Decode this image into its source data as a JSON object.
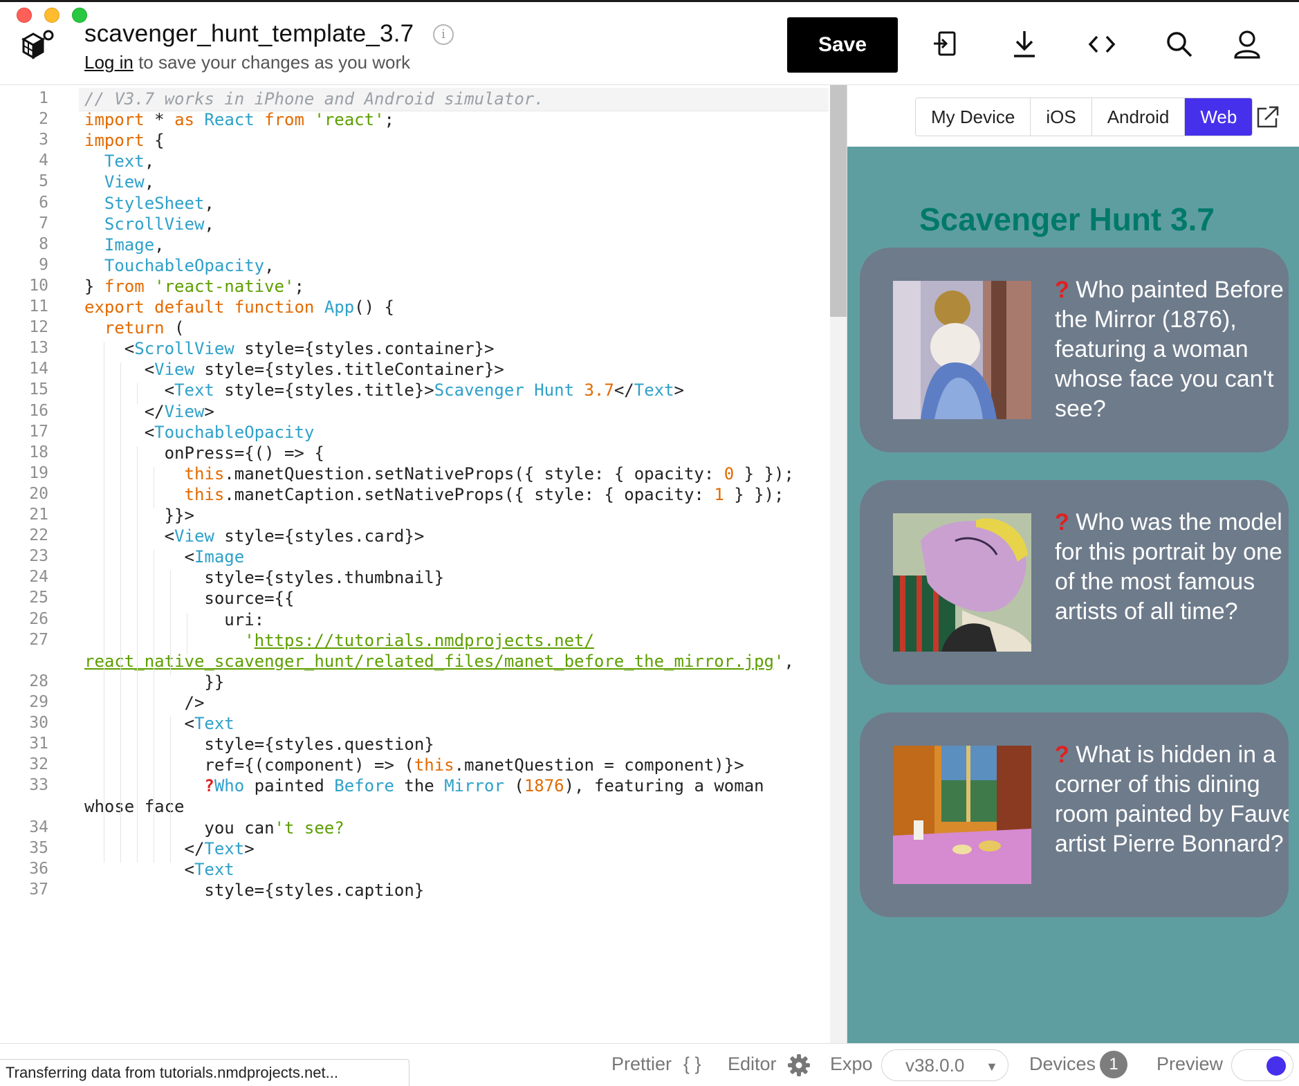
{
  "header": {
    "title": "scavenger_hunt_template_3.7",
    "info_icon": "info-icon",
    "login_link": "Log in",
    "subtitle_rest": " to save your changes as you work",
    "save_label": "Save",
    "icons": [
      "import-project-icon",
      "download-icon",
      "embed-code-icon",
      "search-icon",
      "user-account-icon"
    ]
  },
  "editor": {
    "lines": [
      {
        "n": "1",
        "html": "<span class=\"c\">// V3.7 works in iPhone and Android simulator.</span>"
      },
      {
        "n": "2",
        "html": "<span class=\"k\">import</span> * <span class=\"k\">as</span> <span class=\"b\">React</span> <span class=\"k\">from</span> <span class=\"s\">'react'</span>;"
      },
      {
        "n": "3",
        "html": "<span class=\"k\">import</span> {"
      },
      {
        "n": "4",
        "html": "  <span class=\"b\">Text</span>,"
      },
      {
        "n": "5",
        "html": "  <span class=\"b\">View</span>,"
      },
      {
        "n": "6",
        "html": "  <span class=\"b\">StyleSheet</span>,"
      },
      {
        "n": "7",
        "html": "  <span class=\"b\">ScrollView</span>,"
      },
      {
        "n": "8",
        "html": "  <span class=\"b\">Image</span>,"
      },
      {
        "n": "9",
        "html": "  <span class=\"b\">TouchableOpacity</span>,"
      },
      {
        "n": "10",
        "html": "} <span class=\"k\">from</span> <span class=\"s\">'react-native'</span>;"
      },
      {
        "n": "11",
        "html": "<span class=\"k\">export</span> <span class=\"k\">default</span> <span class=\"k\">function</span> <span class=\"b\">App</span>() {"
      },
      {
        "n": "12",
        "html": "  <span class=\"k\">return</span> ("
      },
      {
        "n": "13",
        "html": "    &lt;<span class=\"b\">ScrollView</span> style={styles.container}&gt;"
      },
      {
        "n": "14",
        "html": "      &lt;<span class=\"b\">View</span> style={styles.titleContainer}&gt;"
      },
      {
        "n": "15",
        "html": "        &lt;<span class=\"b\">Text</span> style={styles.title}&gt;<span class=\"b\">Scavenger Hunt</span> <span class=\"n\">3.7</span>&lt;/<span class=\"b\">Text</span>&gt;"
      },
      {
        "n": "16",
        "html": "      &lt;/<span class=\"b\">View</span>&gt;"
      },
      {
        "n": "17",
        "html": "      &lt;<span class=\"b\">TouchableOpacity</span>"
      },
      {
        "n": "18",
        "html": "        onPress={() =&gt; {"
      },
      {
        "n": "19",
        "html": "          <span class=\"k\">this</span>.manetQuestion.setNativeProps({ style: { opacity: <span class=\"n\">0</span> } });"
      },
      {
        "n": "20",
        "html": "          <span class=\"k\">this</span>.manetCaption.setNativeProps({ style: { opacity: <span class=\"n\">1</span> } });"
      },
      {
        "n": "21",
        "html": "        }}&gt;"
      },
      {
        "n": "22",
        "html": "        &lt;<span class=\"b\">View</span> style={styles.card}&gt;"
      },
      {
        "n": "23",
        "html": "          &lt;<span class=\"b\">Image</span>"
      },
      {
        "n": "24",
        "html": "            style={styles.thumbnail}"
      },
      {
        "n": "25",
        "html": "            source={{"
      },
      {
        "n": "26",
        "html": "              uri:"
      },
      {
        "n": "27",
        "html": "                <span class=\"s\">'</span><span class=\"u\">https://tutorials.nmdprojects.net/</span>"
      },
      {
        "n": "",
        "html": "<span class=\"u\">react_native_scavenger_hunt/related_files/manet_before_the_mirror.jpg</span><span class=\"s\">'</span>,"
      },
      {
        "n": "28",
        "html": "            }}"
      },
      {
        "n": "29",
        "html": "          /&gt;"
      },
      {
        "n": "30",
        "html": "          &lt;<span class=\"b\">Text</span>"
      },
      {
        "n": "31",
        "html": "            style={styles.question}"
      },
      {
        "n": "32",
        "html": "            ref={(component) =&gt; (<span class=\"k\">this</span>.manetQuestion = component)}&gt;"
      },
      {
        "n": "33",
        "html": "            <span class=\"q\">?</span><span class=\"b\">Who</span> painted <span class=\"b\">Before</span> the <span class=\"b\">Mirror</span> (<span class=\"n\">1876</span>), featuring a woman"
      },
      {
        "n": "",
        "html": "whose face"
      },
      {
        "n": "34",
        "html": "            you can<span class=\"s\">'t see?</span>"
      },
      {
        "n": "35",
        "html": "          &lt;/<span class=\"b\">Text</span>&gt;"
      },
      {
        "n": "36",
        "html": "          &lt;<span class=\"b\">Text</span>"
      },
      {
        "n": "37",
        "html": "            style={styles.caption}"
      }
    ]
  },
  "preview": {
    "tabs": [
      {
        "label": "My Device",
        "active": false
      },
      {
        "label": "iOS",
        "active": false
      },
      {
        "label": "Android",
        "active": false
      },
      {
        "label": "Web",
        "active": true
      }
    ],
    "popout_icon": "external-link-icon",
    "app_title": "Scavenger Hunt 3.7",
    "cards": [
      {
        "qmark": "?",
        "text": " Who painted Before\nthe Mirror (1876),\nfeaturing a woman\nwhose face you can't\nsee?",
        "image": "woman-before-mirror-painting"
      },
      {
        "qmark": "?",
        "text": " Who was the model\nfor this portrait by one\nof the most famous\nartists of all time?",
        "image": "sleeping-woman-portrait-painting"
      },
      {
        "qmark": "?",
        "text": " What is hidden in a\ncorner of this dining\nroom painted by Fauve\nartist Pierre Bonnard?",
        "image": "dining-room-painting"
      }
    ],
    "colors": {
      "screen_bg": "#5f9ea0",
      "card_bg": "#6e7b8b",
      "title": "#00796b",
      "accent": "#4630eb"
    }
  },
  "footer": {
    "status": "Transferring data from tutorials.nmdprojects.net...",
    "prettier_label": "Prettier",
    "prettier_icon": "{ }",
    "editor_label": "Editor",
    "expo_label": "Expo",
    "version": "v38.0.0",
    "devices_label": "Devices",
    "devices_count": "1",
    "preview_label": "Preview"
  }
}
